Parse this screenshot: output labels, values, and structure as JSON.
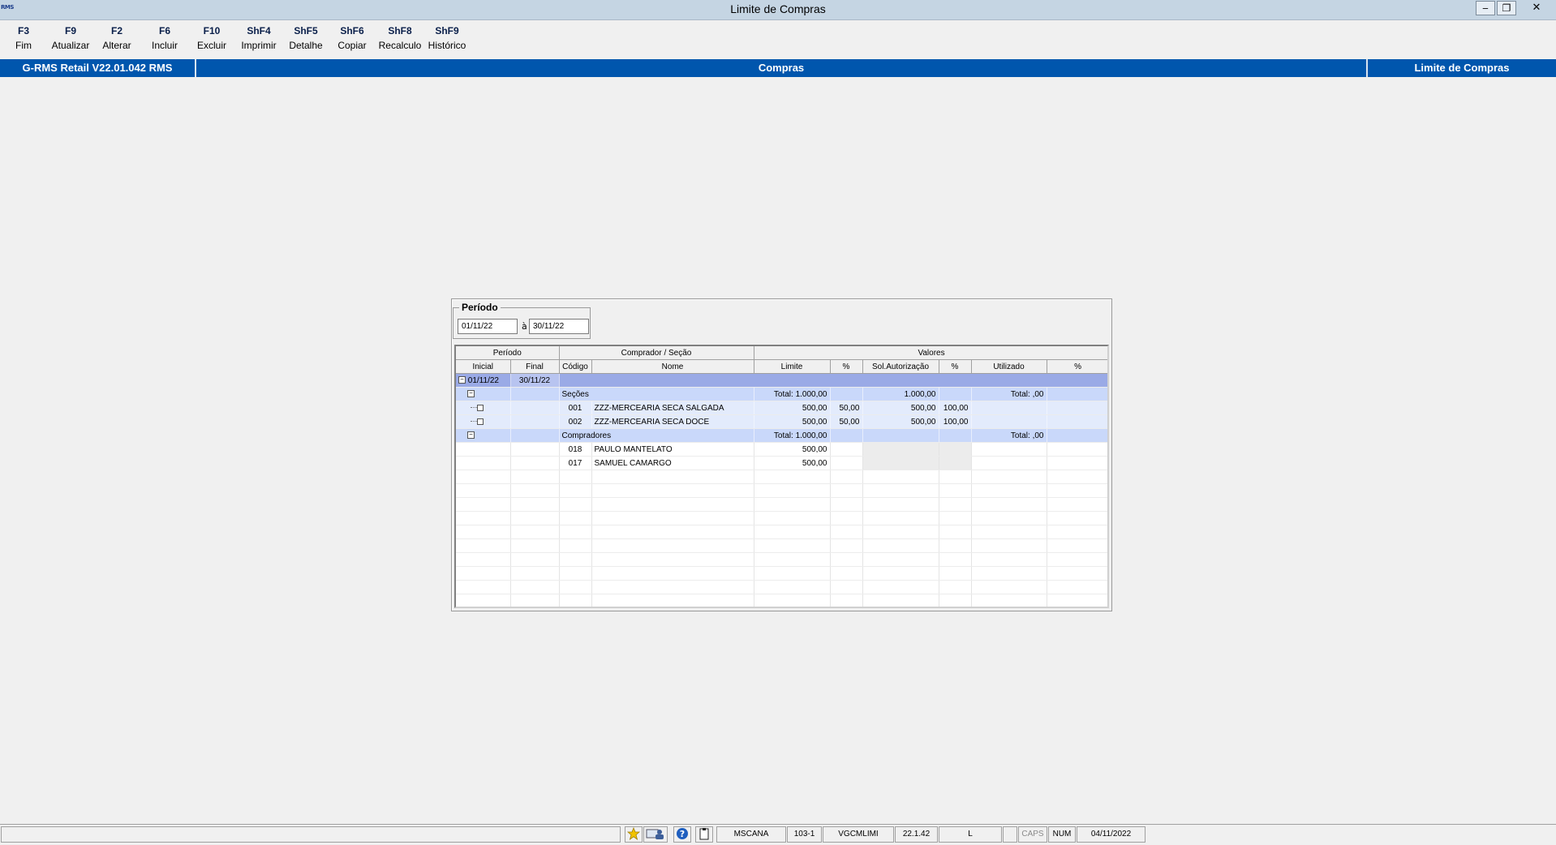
{
  "window": {
    "title": "Limite de Compras",
    "logo_text": "RMS",
    "minimize_glyph": "‒",
    "restore_glyph": "❐",
    "close_glyph": "✕"
  },
  "toolbar": [
    {
      "key": "F3",
      "label": "Fim"
    },
    {
      "key": "F9",
      "label": "Atualizar"
    },
    {
      "key": "F2",
      "label": "Alterar"
    },
    {
      "key": "F6",
      "label": "Incluir"
    },
    {
      "key": "F10",
      "label": "Excluir"
    },
    {
      "key": "ShF4",
      "label": "Imprimir"
    },
    {
      "key": "ShF5",
      "label": "Detalhe"
    },
    {
      "key": "ShF6",
      "label": "Copiar"
    },
    {
      "key": "ShF8",
      "label": "Recalculo"
    },
    {
      "key": "ShF9",
      "label": "Histórico"
    }
  ],
  "header": {
    "version": "G-RMS Retail V22.01.042 RMS",
    "module": "Compras",
    "screen": "Limite de Compras"
  },
  "periodo": {
    "legend": "Período",
    "start": "01/11/22",
    "separator": "à",
    "end": "30/11/22"
  },
  "grid": {
    "group_headers": {
      "periodo": "Período",
      "comprador": "Comprador / Seção",
      "valores": "Valores"
    },
    "columns": {
      "inicial": "Inicial",
      "final": "Final",
      "codigo": "Código",
      "nome": "Nome",
      "limite": "Limite",
      "pct1": "%",
      "sol": "Sol.Autorização",
      "pct2": "%",
      "utilizado": "Utilizado",
      "pct3": "%"
    },
    "period_row": {
      "inicial": "01/11/22",
      "final": "30/11/22"
    },
    "secoes": {
      "label": "Seções",
      "limite_total": "Total: 1.000,00",
      "sol_total": "1.000,00",
      "utilizado_total": "Total: ,00",
      "items": [
        {
          "codigo": "001",
          "nome": "ZZZ-MERCEARIA SECA SALGADA",
          "limite": "500,00",
          "pct1": "50,00",
          "sol": "500,00",
          "pct2": "100,00"
        },
        {
          "codigo": "002",
          "nome": "ZZZ-MERCEARIA SECA DOCE",
          "limite": "500,00",
          "pct1": "50,00",
          "sol": "500,00",
          "pct2": "100,00"
        }
      ]
    },
    "compradores": {
      "label": "Compradores",
      "limite_total": "Total: 1.000,00",
      "utilizado_total": "Total: ,00",
      "items": [
        {
          "codigo": "018",
          "nome": "PAULO MANTELATO",
          "limite": "500,00"
        },
        {
          "codigo": "017",
          "nome": "SAMUEL CAMARGO",
          "limite": "500,00"
        }
      ]
    }
  },
  "statusbar": {
    "user": "MSCANA",
    "branch": "103-1",
    "program": "VGCMLIMI",
    "version": "22.1.42",
    "mode": "L",
    "caps": "CAPS",
    "num": "NUM",
    "date": "04/11/2022"
  }
}
